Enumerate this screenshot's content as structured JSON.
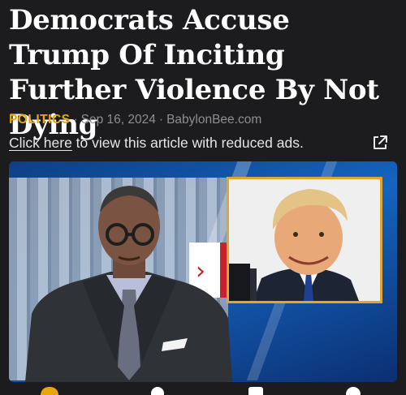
{
  "article": {
    "headline": "Democrats Accuse Trump Of Inciting Further Violence By Not Dying",
    "category": "POLITICS",
    "date": "Sep 16, 2024",
    "source": "BabylonBee.com",
    "separator": "·"
  },
  "ads_notice": {
    "link_text": "Click here",
    "rest_text": " to view this article with reduced ads."
  },
  "colors": {
    "background": "#1c1c1e",
    "category": "#e8a50c",
    "meta": "#8e8e93",
    "inset_border": "#e3a531"
  },
  "icons": {
    "external_link": "external-link-icon"
  }
}
